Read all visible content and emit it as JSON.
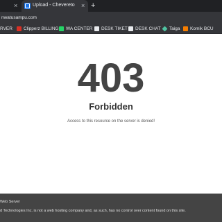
{
  "browser": {
    "tabs": [
      {
        "label": ""
      },
      {
        "label": "Upload - Chevereto"
      }
    ],
    "new_tab_label": "+",
    "close_glyph": "×",
    "address": "nwatusampu.com",
    "bookmarks": [
      {
        "label": "RVER",
        "icon": ""
      },
      {
        "label": "Clipperz BILLING",
        "icon": "clipperz-icon"
      },
      {
        "label": "WA CENTER",
        "icon": "whatsapp-icon"
      },
      {
        "label": "DESK TIKET",
        "icon": "desk-icon"
      },
      {
        "label": "DESK CHAT",
        "icon": "desk-icon"
      },
      {
        "label": "Taiga",
        "icon": "taiga-icon"
      },
      {
        "label": "Komik BCU",
        "icon": "blogger-icon"
      }
    ]
  },
  "error": {
    "code": "403",
    "title": "Forbidden",
    "message": "Access to this resource on the server is denied!"
  },
  "footer": {
    "line1": "Web Server",
    "line2": "d Technologies Inc. is not a web hosting company and, as such, has no control over content found on this site."
  },
  "colors": {
    "chrome_dark": "#202124",
    "chrome_toolbar": "#35363a",
    "error_text": "#444444",
    "footer_bg": "#444444"
  }
}
